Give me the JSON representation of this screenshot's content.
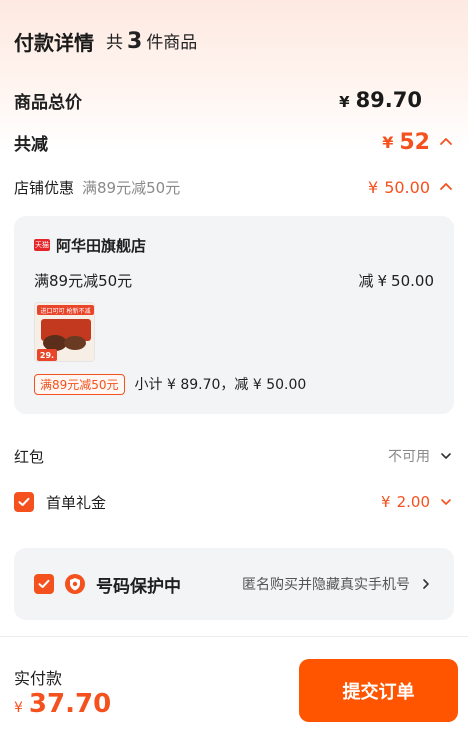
{
  "header": {
    "title": "付款详情",
    "count_prefix": "共",
    "count": "3",
    "count_suffix": "件商品"
  },
  "total": {
    "label": "商品总价",
    "yen": "¥",
    "amount": "89.70"
  },
  "reduce": {
    "label": "共减",
    "yen": "¥",
    "amount": "52"
  },
  "shop_discount": {
    "label": "店铺优惠",
    "desc": "满89元减50元",
    "yen": "¥",
    "amount": "50.00"
  },
  "store_card": {
    "badge": "天猫",
    "store_name": "阿华田旗舰店",
    "promo_text": "满89元减50元",
    "promo_amount_prefix": "减",
    "yen": "¥",
    "promo_amount": "50.00",
    "product_image_texts": {
      "top": "进口可可 枪新不减",
      "price": "29."
    },
    "promo_tag": "满89元减50元",
    "subtotal": "小计 ¥ 89.70，减 ¥ 50.00"
  },
  "red_packet": {
    "label": "红包",
    "status": "不可用"
  },
  "first_gift": {
    "label": "首单礼金",
    "yen": "¥",
    "amount": "2.00"
  },
  "protect": {
    "title": "号码保护中",
    "desc": "匿名购买并隐藏真实手机号"
  },
  "footer": {
    "pay_label": "实付款",
    "yen": "¥",
    "amount": "37.70",
    "submit_label": "提交订单"
  },
  "colors": {
    "accent": "#f4511e",
    "button": "#ff5500",
    "card_bg": "#f3f4f6"
  }
}
